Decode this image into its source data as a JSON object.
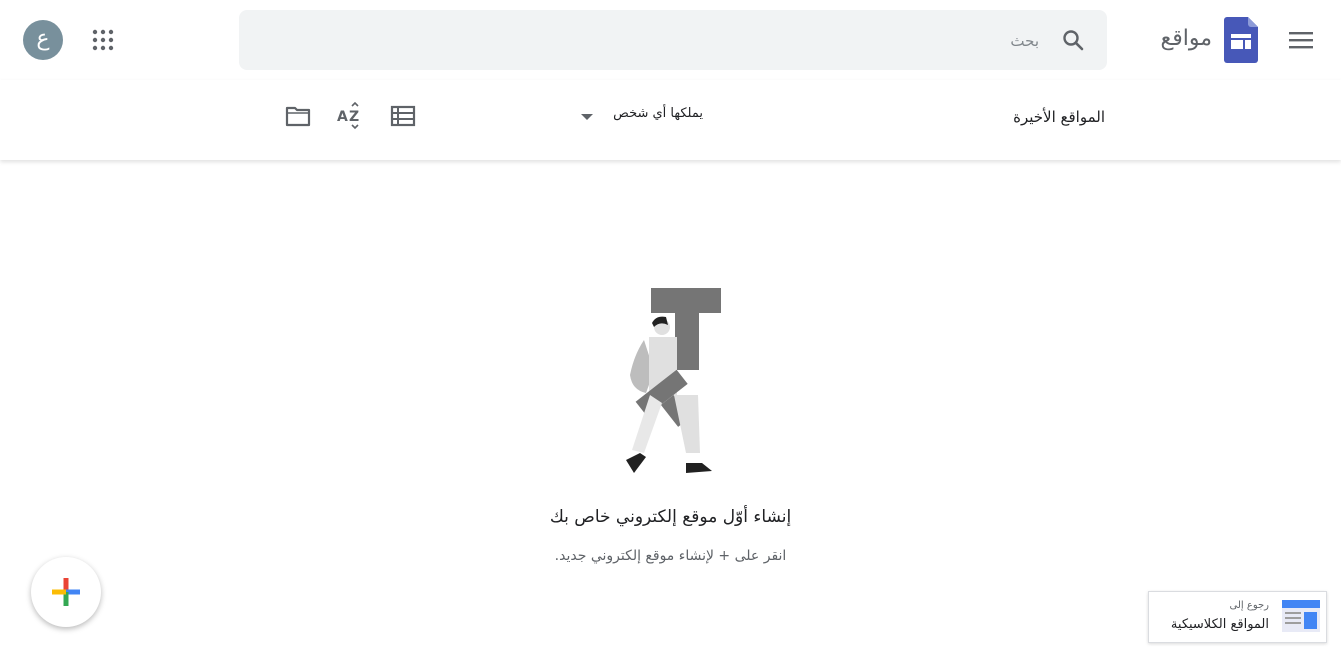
{
  "header": {
    "app_name": "مواقع",
    "search_placeholder": "بحث",
    "avatar_initial": "ع"
  },
  "toolbar": {
    "recent_label": "المواقع الأخيرة",
    "owner_filter_label": "يملكها أي شخص"
  },
  "empty_state": {
    "title": "إنشاء أوّل موقع إلكتروني خاص بك",
    "subtitle": "انقر على + لإنشاء موقع إلكتروني جديد."
  },
  "classic_link": {
    "small_label": "رجوع إلى",
    "main_label": "المواقع الكلاسيكية"
  },
  "icons": {
    "menu": "menu-icon",
    "logo": "sites-logo-icon",
    "search": "search-icon",
    "apps": "apps-grid-icon",
    "folder": "folder-icon",
    "sort": "sort-az-icon",
    "list": "list-view-icon",
    "create": "plus-icon"
  },
  "colors": {
    "brand": "#4758b8",
    "avatar_bg": "#78909c"
  }
}
